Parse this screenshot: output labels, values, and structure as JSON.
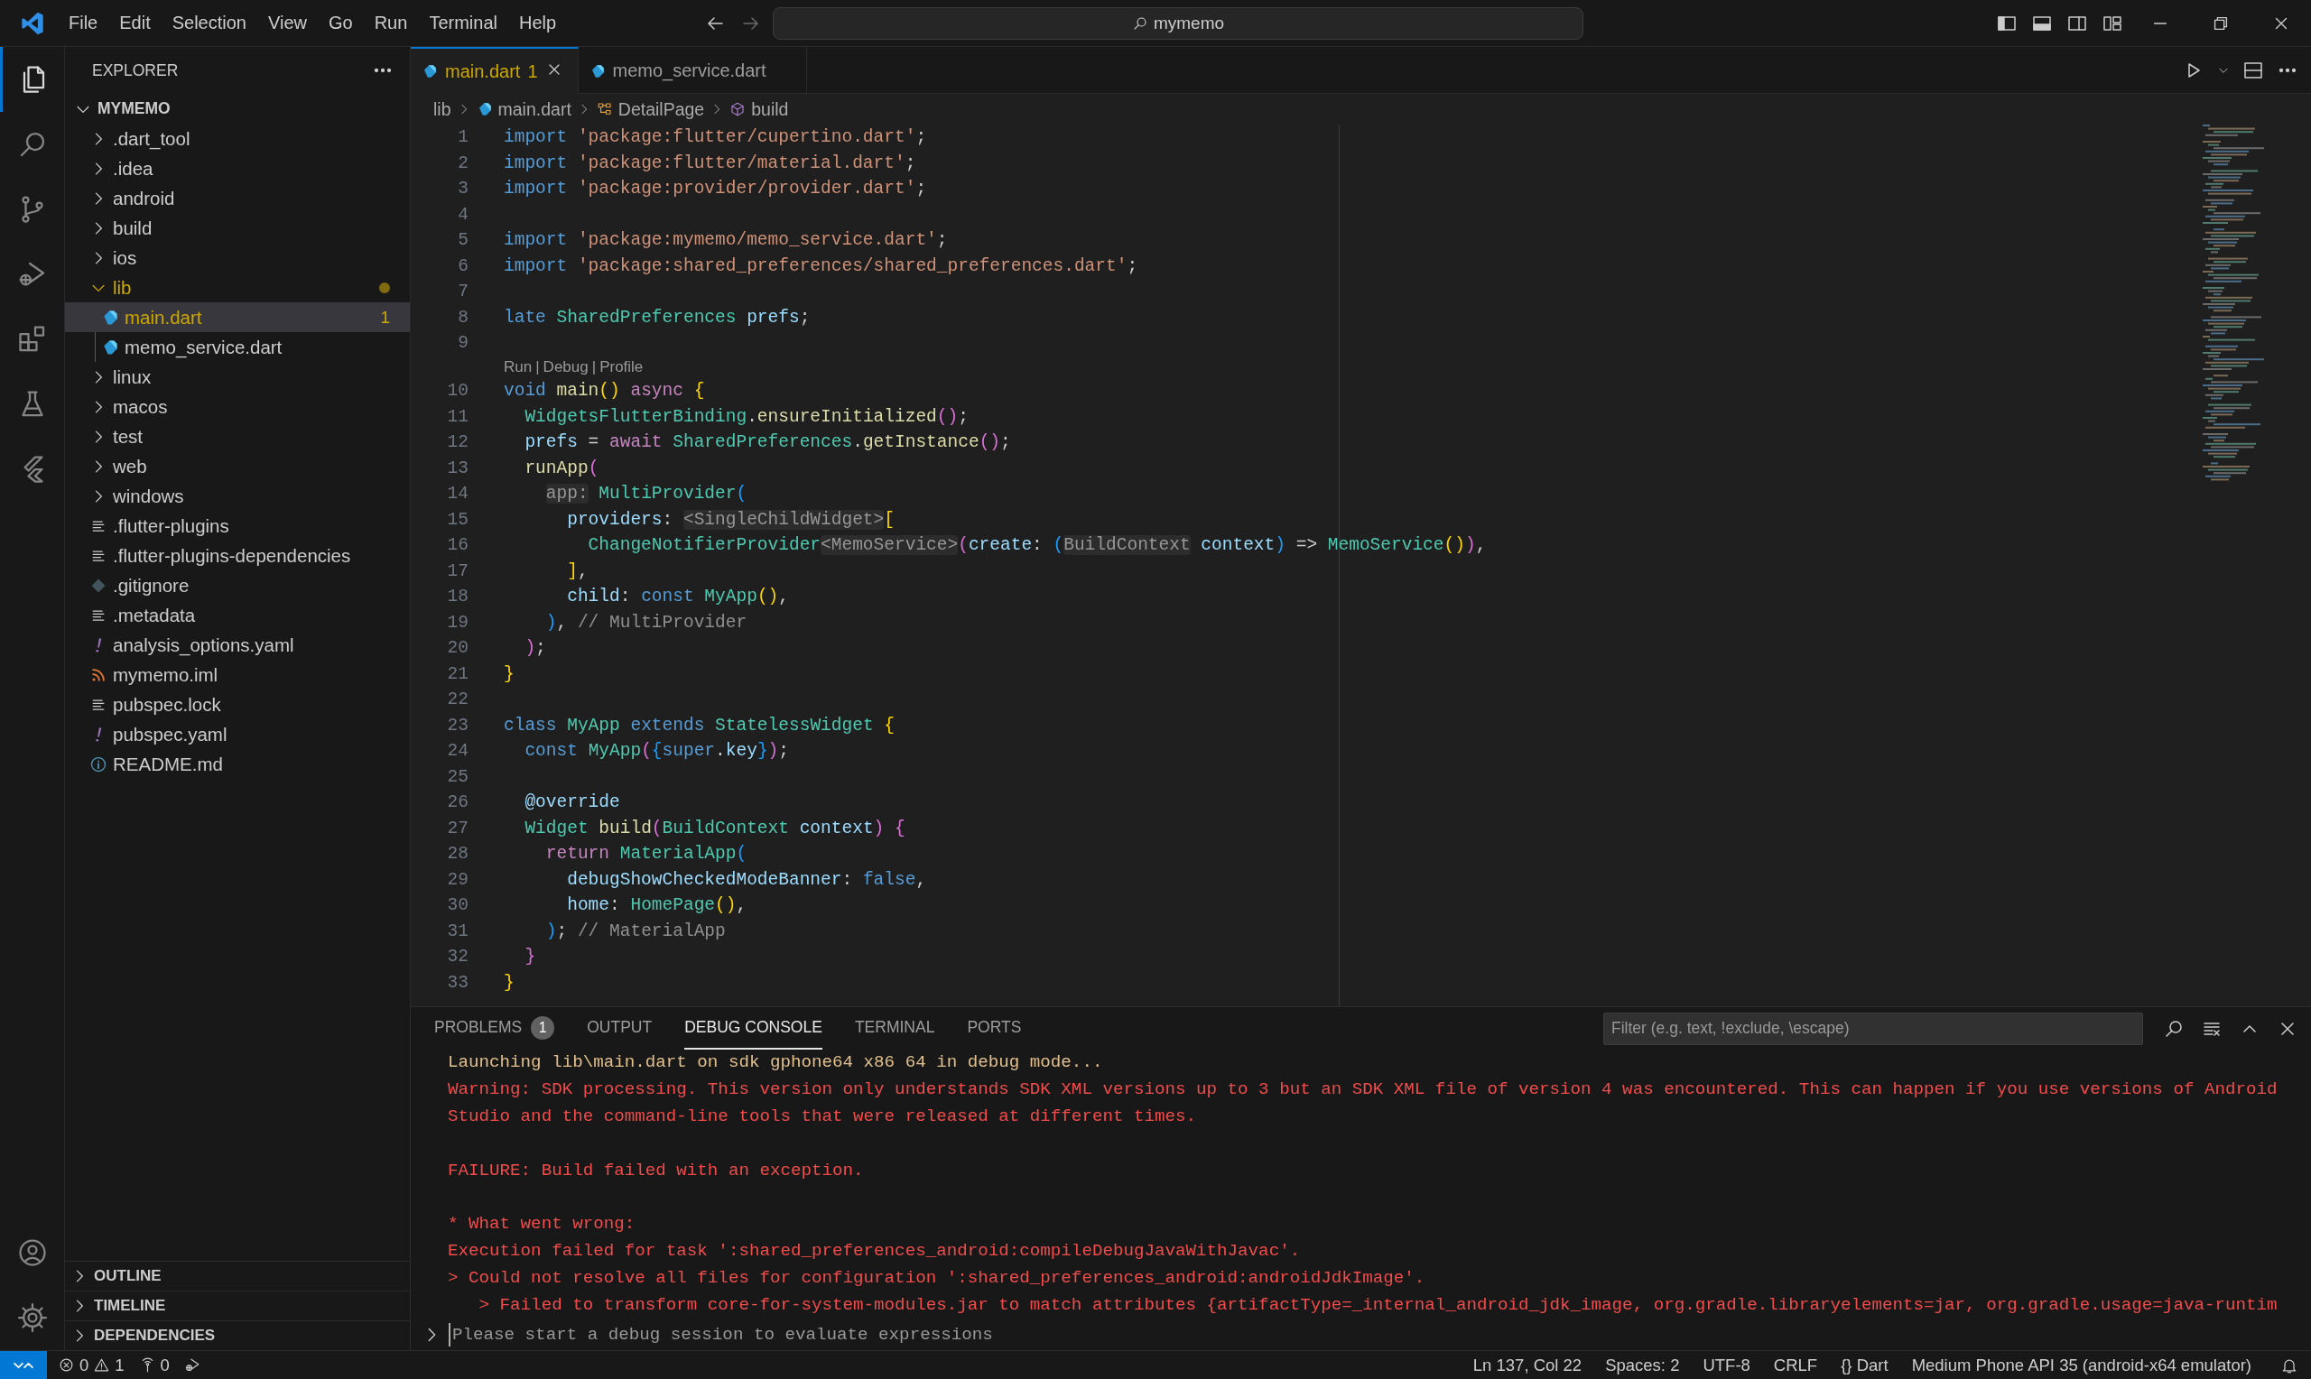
{
  "title_bar": {
    "menu": [
      "File",
      "Edit",
      "Selection",
      "View",
      "Go",
      "Run",
      "Terminal",
      "Help"
    ],
    "command_center": {
      "label": "mymemo"
    }
  },
  "activity_bar": {
    "items": [
      {
        "kind": "explorer",
        "selected": true
      },
      {
        "kind": "search",
        "selected": false
      },
      {
        "kind": "scm",
        "selected": false
      },
      {
        "kind": "debug",
        "selected": false
      },
      {
        "kind": "extensions",
        "selected": false
      },
      {
        "kind": "testing",
        "selected": false
      },
      {
        "kind": "custom_view",
        "selected": false
      }
    ],
    "bottom": [
      {
        "kind": "account"
      },
      {
        "kind": "settings"
      }
    ]
  },
  "sidebar": {
    "title": "EXPLORER",
    "root": {
      "label": "MYMEMO",
      "expanded": true,
      "items": [
        {
          "label": ".dart_tool",
          "kind": "folder",
          "expanded": false,
          "selected": false,
          "warning": false
        },
        {
          "label": ".idea",
          "kind": "folder",
          "expanded": false,
          "selected": false,
          "warning": false
        },
        {
          "label": "android",
          "kind": "folder",
          "expanded": false,
          "selected": false,
          "warning": false
        },
        {
          "label": "build",
          "kind": "folder",
          "expanded": false,
          "selected": false,
          "warning": false
        },
        {
          "label": "ios",
          "kind": "folder",
          "expanded": false,
          "selected": false,
          "warning": false
        },
        {
          "label": "lib",
          "kind": "folder",
          "expanded": true,
          "selected": false,
          "warning": true,
          "children": [
            {
              "label": "main.dart",
              "kind": "dart",
              "selected": true,
              "warning": true,
              "badge": "1"
            },
            {
              "label": "memo_service.dart",
              "kind": "dart",
              "selected": false,
              "warning": false
            }
          ]
        },
        {
          "label": "linux",
          "kind": "folder",
          "expanded": false,
          "selected": false,
          "warning": false
        },
        {
          "label": "macos",
          "kind": "folder",
          "expanded": false,
          "selected": false,
          "warning": false
        },
        {
          "label": "test",
          "kind": "folder",
          "expanded": false,
          "selected": false,
          "warning": false
        },
        {
          "label": "web",
          "kind": "folder",
          "expanded": false,
          "selected": false,
          "warning": false
        },
        {
          "label": "windows",
          "kind": "folder",
          "expanded": false,
          "selected": false,
          "warning": false
        },
        {
          "label": ".flutter-plugins",
          "kind": "text",
          "selected": false,
          "warning": false
        },
        {
          "label": ".flutter-plugins-dependencies",
          "kind": "text",
          "selected": false,
          "warning": false
        },
        {
          "label": ".gitignore",
          "kind": "git",
          "selected": false,
          "warning": false
        },
        {
          "label": ".metadata",
          "kind": "text",
          "selected": false,
          "warning": false
        },
        {
          "label": "analysis_options.yaml",
          "kind": "yaml",
          "selected": false,
          "warning": false
        },
        {
          "label": "mymemo.iml",
          "kind": "feed",
          "selected": false,
          "warning": false
        },
        {
          "label": "pubspec.lock",
          "kind": "text",
          "selected": false,
          "warning": false
        },
        {
          "label": "pubspec.yaml",
          "kind": "yaml",
          "selected": false,
          "warning": false
        },
        {
          "label": "README.md",
          "kind": "info",
          "selected": false,
          "warning": false
        }
      ]
    },
    "sections": [
      {
        "label": "OUTLINE",
        "expanded": false
      },
      {
        "label": "TIMELINE",
        "expanded": false
      },
      {
        "label": "DEPENDENCIES",
        "expanded": false
      }
    ]
  },
  "editor": {
    "tabs": [
      {
        "label": "main.dart",
        "badge": "1",
        "warning": true,
        "selected": true
      },
      {
        "label": "memo_service.dart",
        "warning": false,
        "selected": false
      }
    ],
    "breadcrumb": [
      {
        "label": "lib",
        "kind": "folder"
      },
      {
        "label": "main.dart",
        "kind": "dart"
      },
      {
        "label": "DetailPage",
        "kind": "class"
      },
      {
        "label": "build",
        "kind": "method"
      }
    ],
    "lines": [
      {
        "kind": "code",
        "number": "1",
        "tokens": [
          {
            "text": "import ",
            "kind": "keyword"
          },
          {
            "text": "'package:flutter/cupertino.dart'",
            "kind": "string"
          },
          {
            "text": ";",
            "kind": "punctuation"
          }
        ]
      },
      {
        "kind": "code",
        "number": "2",
        "tokens": [
          {
            "text": "import ",
            "kind": "keyword"
          },
          {
            "text": "'package:flutter/material.dart'",
            "kind": "string"
          },
          {
            "text": ";",
            "kind": "punctuation"
          }
        ]
      },
      {
        "kind": "code",
        "number": "3",
        "tokens": [
          {
            "text": "import ",
            "kind": "keyword"
          },
          {
            "text": "'package:provider/provider.dart'",
            "kind": "string"
          },
          {
            "text": ";",
            "kind": "punctuation"
          }
        ]
      },
      {
        "kind": "code",
        "number": "4"
      },
      {
        "kind": "code",
        "number": "5",
        "tokens": [
          {
            "text": "import ",
            "kind": "keyword"
          },
          {
            "text": "'package:mymemo/memo_service.dart'",
            "kind": "string"
          },
          {
            "text": ";",
            "kind": "punctuation"
          }
        ]
      },
      {
        "kind": "code",
        "number": "6",
        "tokens": [
          {
            "text": "import ",
            "kind": "keyword"
          },
          {
            "text": "'package:shared_preferences/shared_preferences.dart'",
            "kind": "string"
          },
          {
            "text": ";",
            "kind": "punctuation"
          }
        ]
      },
      {
        "kind": "code",
        "number": "7"
      },
      {
        "kind": "code",
        "number": "8",
        "tokens": [
          {
            "text": "late ",
            "kind": "keyword"
          },
          {
            "text": "SharedPreferences ",
            "kind": "type"
          },
          {
            "text": "prefs",
            "kind": "variable"
          },
          {
            "text": ";",
            "kind": "punctuation"
          }
        ]
      },
      {
        "kind": "code",
        "number": "9"
      },
      {
        "kind": "codelens",
        "links": [
          "Run",
          "Debug",
          "Profile"
        ],
        "separators": [
          "|",
          "|"
        ]
      },
      {
        "kind": "code",
        "number": "10",
        "tokens": [
          {
            "text": "void ",
            "kind": "keyword"
          },
          {
            "text": "main",
            "kind": "function"
          },
          {
            "text": "()",
            "kind": "bracket1"
          },
          {
            "text": " async ",
            "kind": "control"
          },
          {
            "text": "{",
            "kind": "bracket1"
          }
        ]
      },
      {
        "kind": "code",
        "number": "11",
        "tokens": [
          {
            "text": "  WidgetsFlutterBinding",
            "kind": "type"
          },
          {
            "text": ".",
            "kind": "punctuation"
          },
          {
            "text": "ensureInitialized",
            "kind": "function"
          },
          {
            "text": "()",
            "kind": "bracket2"
          },
          {
            "text": ";",
            "kind": "punctuation"
          }
        ]
      },
      {
        "kind": "code",
        "number": "12",
        "tokens": [
          {
            "text": "  prefs",
            "kind": "variable"
          },
          {
            "text": " = ",
            "kind": "punctuation"
          },
          {
            "text": "await ",
            "kind": "control"
          },
          {
            "text": "SharedPreferences",
            "kind": "type"
          },
          {
            "text": ".",
            "kind": "punctuation"
          },
          {
            "text": "getInstance",
            "kind": "function"
          },
          {
            "text": "()",
            "kind": "bracket2"
          },
          {
            "text": ";",
            "kind": "punctuation"
          }
        ]
      },
      {
        "kind": "code",
        "number": "13",
        "tokens": [
          {
            "text": "  runApp",
            "kind": "function"
          },
          {
            "text": "(",
            "kind": "bracket2"
          }
        ]
      },
      {
        "kind": "code",
        "number": "14",
        "tokens": [
          {
            "text": "    app:",
            "kind": "hint"
          },
          {
            "text": " MultiProvider",
            "kind": "type"
          },
          {
            "text": "(",
            "kind": "bracket3"
          }
        ]
      },
      {
        "kind": "code",
        "number": "15",
        "tokens": [
          {
            "text": "      providers",
            "kind": "variable"
          },
          {
            "text": ": ",
            "kind": "punctuation"
          },
          {
            "text": "<SingleChildWidget>",
            "kind": "hint"
          },
          {
            "text": "[",
            "kind": "bracket1"
          }
        ]
      },
      {
        "kind": "code",
        "number": "16",
        "tokens": [
          {
            "text": "        ChangeNotifierProvider",
            "kind": "type"
          },
          {
            "text": "<MemoService>",
            "kind": "hint"
          },
          {
            "text": "(",
            "kind": "bracket2"
          },
          {
            "text": "create",
            "kind": "variable"
          },
          {
            "text": ": ",
            "kind": "punctuation"
          },
          {
            "text": "(",
            "kind": "bracket3"
          },
          {
            "text": "BuildContext",
            "kind": "hint"
          },
          {
            "text": " context",
            "kind": "variable"
          },
          {
            "text": ")",
            "kind": "bracket3"
          },
          {
            "text": " => ",
            "kind": "punctuation"
          },
          {
            "text": "MemoService",
            "kind": "type"
          },
          {
            "text": "()",
            "kind": "bracket1"
          },
          {
            "text": ")",
            "kind": "bracket2"
          },
          {
            "text": ",",
            "kind": "punctuation"
          }
        ]
      },
      {
        "kind": "code",
        "number": "17",
        "tokens": [
          {
            "text": "      ]",
            "kind": "bracket1"
          },
          {
            "text": ",",
            "kind": "punctuation"
          }
        ]
      },
      {
        "kind": "code",
        "number": "18",
        "tokens": [
          {
            "text": "      child",
            "kind": "variable"
          },
          {
            "text": ": ",
            "kind": "punctuation"
          },
          {
            "text": "const ",
            "kind": "keyword"
          },
          {
            "text": "MyApp",
            "kind": "type"
          },
          {
            "text": "()",
            "kind": "bracket1"
          },
          {
            "text": ",",
            "kind": "punctuation"
          }
        ]
      },
      {
        "kind": "code",
        "number": "19",
        "tokens": [
          {
            "text": "    )",
            "kind": "bracket3"
          },
          {
            "text": ", ",
            "kind": "punctuation"
          },
          {
            "text": "// MultiProvider",
            "kind": "label"
          }
        ]
      },
      {
        "kind": "code",
        "number": "20",
        "tokens": [
          {
            "text": "  )",
            "kind": "bracket2"
          },
          {
            "text": ";",
            "kind": "punctuation"
          }
        ]
      },
      {
        "kind": "code",
        "number": "21",
        "tokens": [
          {
            "text": "}",
            "kind": "bracket1"
          }
        ]
      },
      {
        "kind": "code",
        "number": "22"
      },
      {
        "kind": "code",
        "number": "23",
        "tokens": [
          {
            "text": "class ",
            "kind": "keyword"
          },
          {
            "text": "MyApp",
            "kind": "type"
          },
          {
            "text": " extends ",
            "kind": "keyword"
          },
          {
            "text": "StatelessWidget",
            "kind": "type"
          },
          {
            "text": " {",
            "kind": "bracket1"
          }
        ]
      },
      {
        "kind": "code",
        "number": "24",
        "tokens": [
          {
            "text": "  const ",
            "kind": "keyword"
          },
          {
            "text": "MyApp",
            "kind": "type"
          },
          {
            "text": "(",
            "kind": "bracket2"
          },
          {
            "text": "{",
            "kind": "bracket3"
          },
          {
            "text": "super",
            "kind": "keyword"
          },
          {
            "text": ".",
            "kind": "punctuation"
          },
          {
            "text": "key",
            "kind": "variable"
          },
          {
            "text": "}",
            "kind": "bracket3"
          },
          {
            "text": ")",
            "kind": "bracket2"
          },
          {
            "text": ";",
            "kind": "punctuation"
          }
        ]
      },
      {
        "kind": "code",
        "number": "25"
      },
      {
        "kind": "code",
        "number": "26",
        "tokens": [
          {
            "text": "  @override",
            "kind": "variable"
          }
        ]
      },
      {
        "kind": "code",
        "number": "27",
        "tokens": [
          {
            "text": "  Widget ",
            "kind": "type"
          },
          {
            "text": "build",
            "kind": "function"
          },
          {
            "text": "(",
            "kind": "bracket2"
          },
          {
            "text": "BuildContext ",
            "kind": "type"
          },
          {
            "text": "context",
            "kind": "variable"
          },
          {
            "text": ")",
            "kind": "bracket2"
          },
          {
            "text": " {",
            "kind": "bracket2"
          }
        ]
      },
      {
        "kind": "code",
        "number": "28",
        "tokens": [
          {
            "text": "    return ",
            "kind": "control"
          },
          {
            "text": "MaterialApp",
            "kind": "type"
          },
          {
            "text": "(",
            "kind": "bracket3"
          }
        ]
      },
      {
        "kind": "code",
        "number": "29",
        "tokens": [
          {
            "text": "      debugShowCheckedModeBanner",
            "kind": "variable"
          },
          {
            "text": ": ",
            "kind": "punctuation"
          },
          {
            "text": "false",
            "kind": "keyword"
          },
          {
            "text": ",",
            "kind": "punctuation"
          }
        ]
      },
      {
        "kind": "code",
        "number": "30",
        "tokens": [
          {
            "text": "      home",
            "kind": "variable"
          },
          {
            "text": ": ",
            "kind": "punctuation"
          },
          {
            "text": "HomePage",
            "kind": "type"
          },
          {
            "text": "()",
            "kind": "bracket1"
          },
          {
            "text": ",",
            "kind": "punctuation"
          }
        ]
      },
      {
        "kind": "code",
        "number": "31",
        "tokens": [
          {
            "text": "    )",
            "kind": "bracket3"
          },
          {
            "text": "; ",
            "kind": "punctuation"
          },
          {
            "text": "// MaterialApp",
            "kind": "label"
          }
        ]
      },
      {
        "kind": "code",
        "number": "32",
        "tokens": [
          {
            "text": "  }",
            "kind": "bracket2"
          }
        ]
      },
      {
        "kind": "code",
        "number": "33",
        "tokens": [
          {
            "text": "}",
            "kind": "bracket1"
          }
        ]
      }
    ]
  },
  "panel": {
    "tabs": [
      {
        "label": "PROBLEMS",
        "badge": "1",
        "selected": false
      },
      {
        "label": "OUTPUT",
        "selected": false
      },
      {
        "label": "DEBUG CONSOLE",
        "selected": true
      },
      {
        "label": "TERMINAL",
        "selected": false
      },
      {
        "label": "PORTS",
        "selected": false
      }
    ],
    "filter": {
      "placeholder": "Filter (e.g. text, !exclude, \\escape)"
    },
    "output": [
      {
        "kind": "info",
        "text": "Launching lib\\main.dart on sdk gphone64 x86 64 in debug mode..."
      },
      {
        "kind": "error",
        "text": "Warning: SDK processing. This version only understands SDK XML versions up to 3 but an SDK XML file of version 4 was encountered. This can happen if you use versions of Android"
      },
      {
        "kind": "error",
        "text": "Studio and the command-line tools that were released at different times."
      },
      {
        "kind": "blank"
      },
      {
        "kind": "error",
        "text": "FAILURE: Build failed with an exception."
      },
      {
        "kind": "blank"
      },
      {
        "kind": "error",
        "text": "* What went wrong:"
      },
      {
        "kind": "error",
        "text": "Execution failed for task ':shared_preferences_android:compileDebugJavaWithJavac'."
      },
      {
        "kind": "error",
        "text": "> Could not resolve all files for configuration ':shared_preferences_android:androidJdkImage'."
      },
      {
        "kind": "error",
        "text": "   > Failed to transform core-for-system-modules.jar to match attributes {artifactType=_internal_android_jdk_image, org.gradle.libraryelements=jar, org.gradle.usage=java-runtim"
      }
    ],
    "input": {
      "placeholder": "Please start a debug session to evaluate expressions"
    }
  },
  "status_bar": {
    "errors": "0",
    "warnings": "1",
    "ports": "0",
    "right": [
      "Ln 137, Col 22",
      "Spaces: 2",
      "UTF-8",
      "CRLF",
      "{} Dart",
      "Medium Phone API 35 (android-x64 emulator)"
    ]
  }
}
